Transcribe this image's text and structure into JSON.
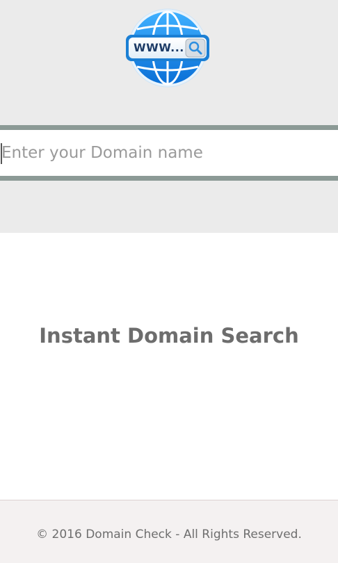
{
  "header": {
    "logo": {
      "icon": "www-globe-search-icon",
      "text": "WWW..."
    }
  },
  "search": {
    "placeholder": "Enter your Domain name",
    "value": ""
  },
  "main": {
    "title": "Instant Domain Search"
  },
  "footer": {
    "copyright": "© 2016 Domain Check - All Rights Reserved."
  },
  "colors": {
    "header_bg": "#ebebeb",
    "search_border": "#8c9a96",
    "title": "#6d6d6d",
    "footer_bg": "#f4f1f1",
    "logo_blue": "#1e90e8"
  }
}
